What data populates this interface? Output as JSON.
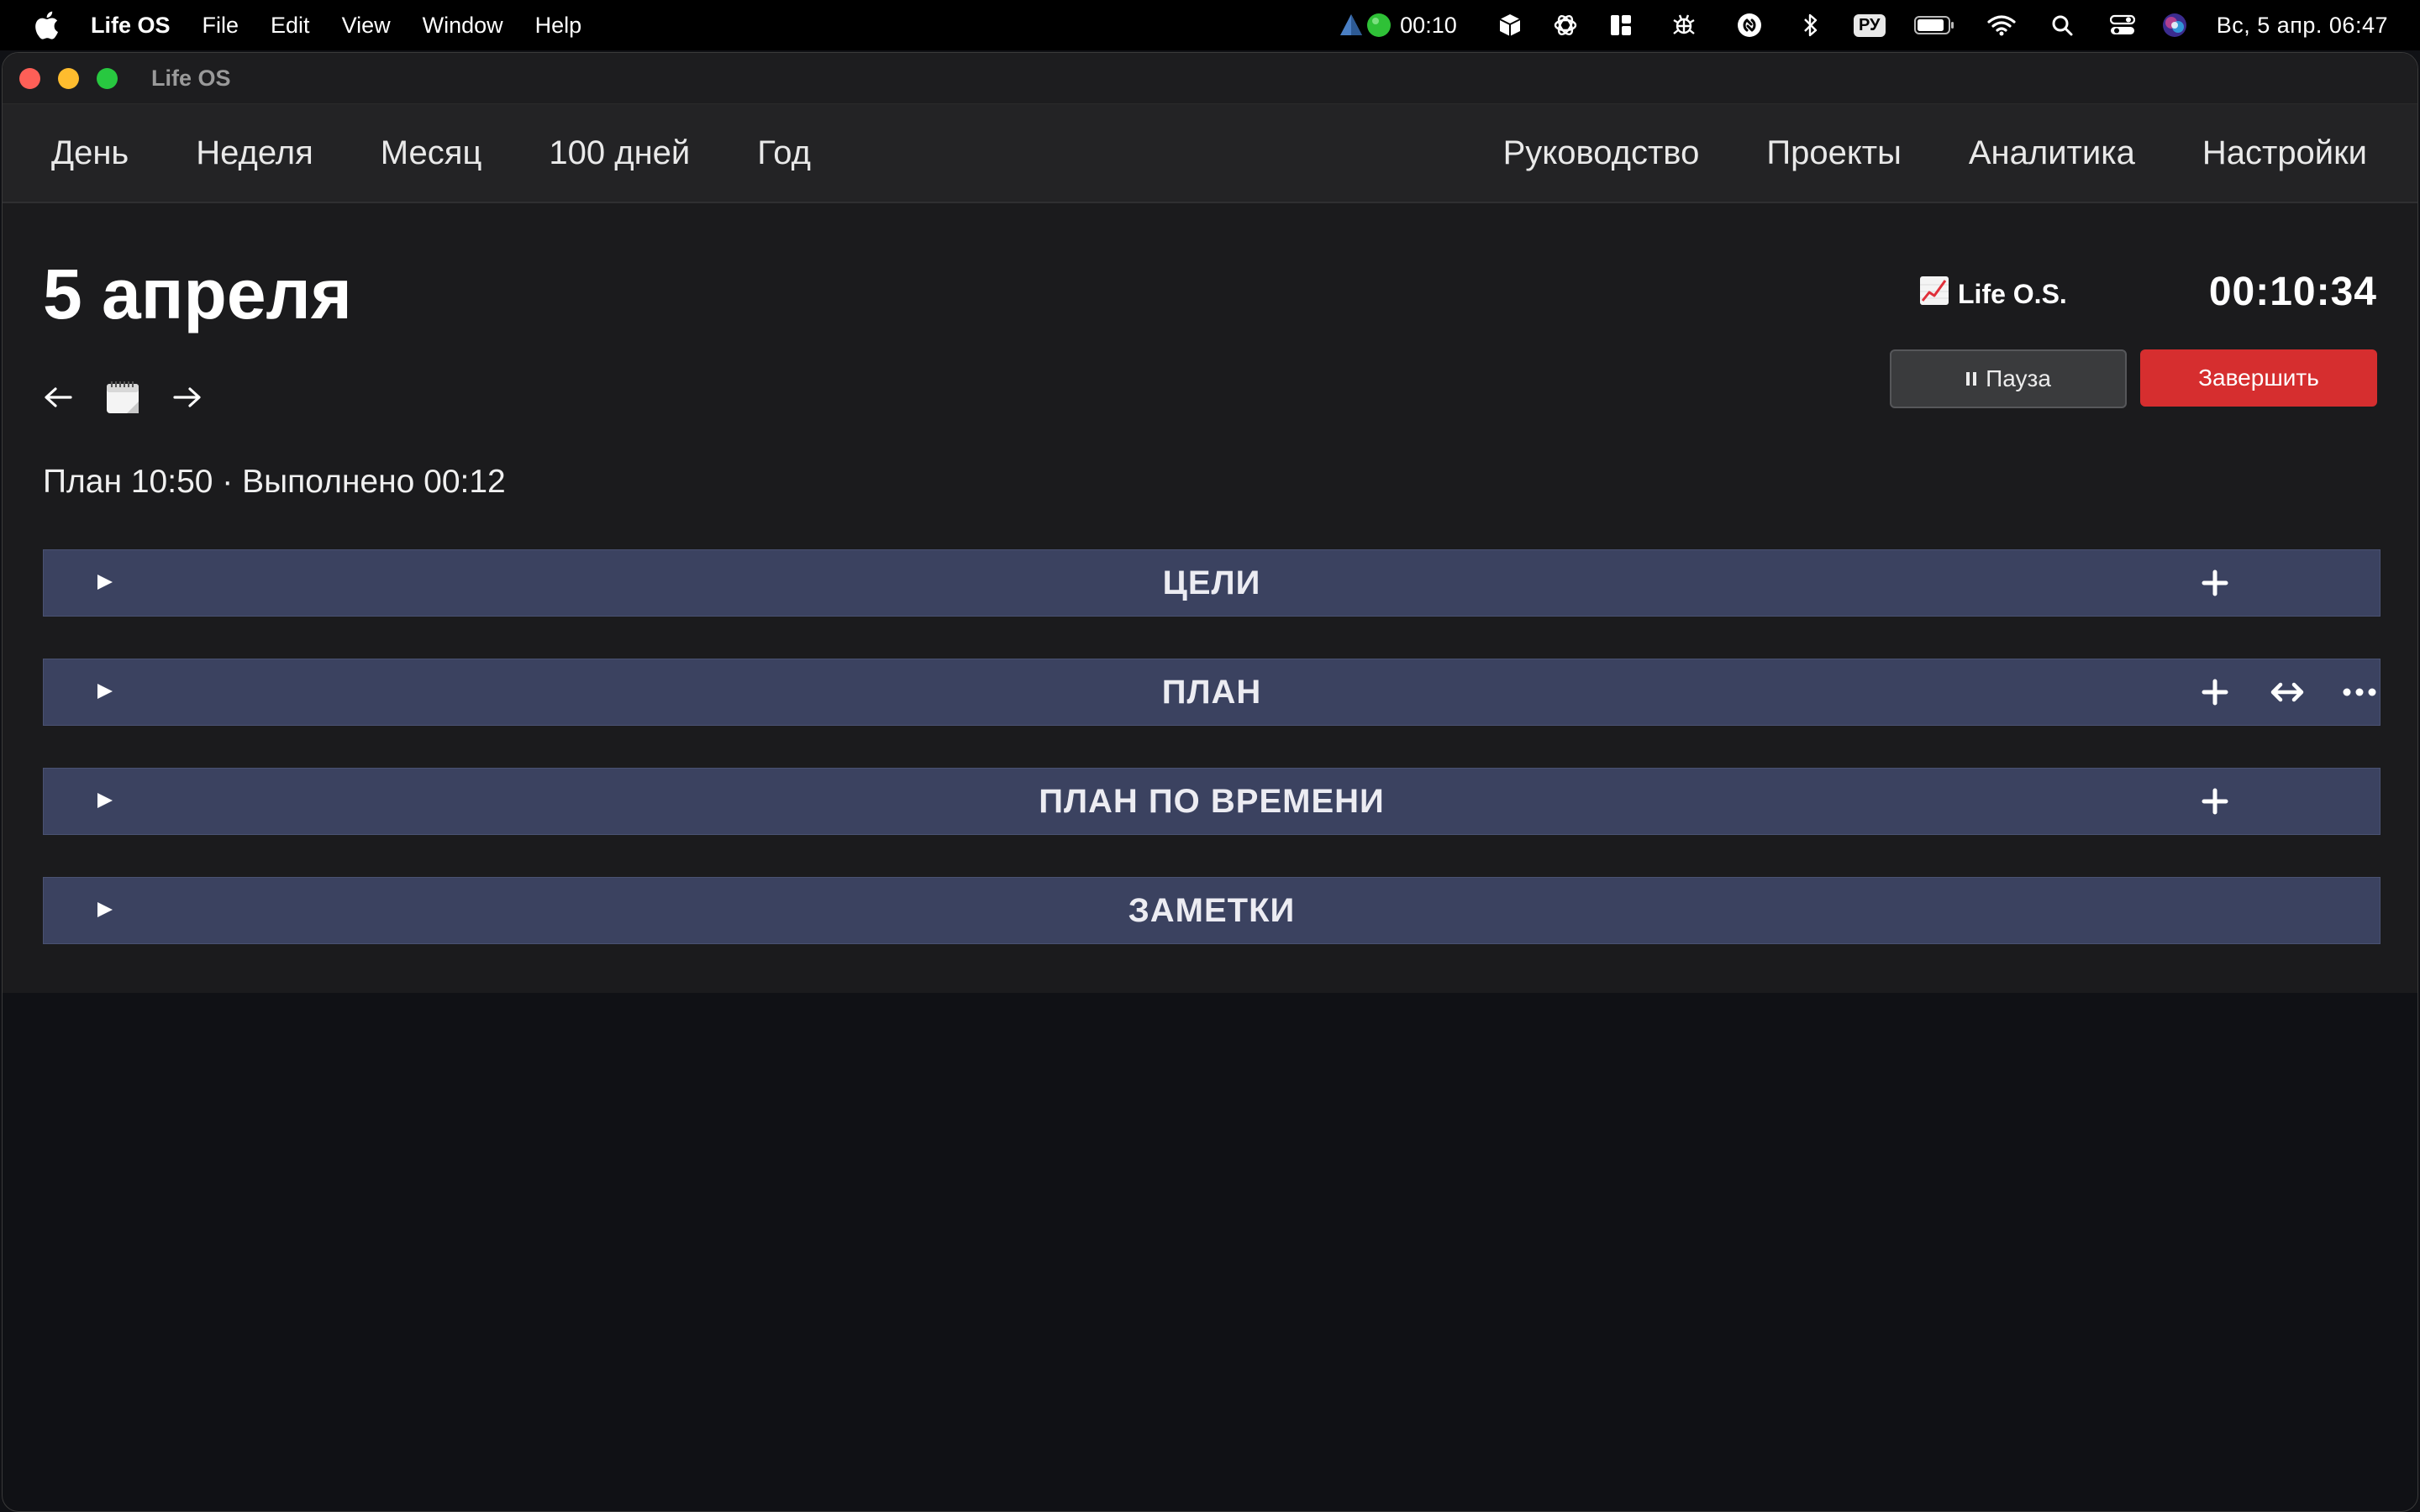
{
  "menubar": {
    "app_name": "Life OS",
    "items": [
      "File",
      "Edit",
      "View",
      "Window",
      "Help"
    ],
    "timer": "00:10",
    "keyboard_layout": "РУ",
    "datetime": "Вс, 5 апр.  06:47"
  },
  "window": {
    "title": "Life OS"
  },
  "nav": {
    "left": [
      "День",
      "Неделя",
      "Месяц",
      "100 дней",
      "Год"
    ],
    "right": [
      "Руководство",
      "Проекты",
      "Аналитика",
      "Настройки"
    ]
  },
  "day": {
    "title": "5 апреля",
    "summary": "План 10:50 · Выполнено 00:12"
  },
  "tracker": {
    "brand": "Life O.S.",
    "timer": "00:10:34",
    "pause_label": "Пауза",
    "finish_label": "Завершить"
  },
  "sections": [
    {
      "title": "ЦЕЛИ"
    },
    {
      "title": "ПЛАН"
    },
    {
      "title": "ПЛАН ПО ВРЕМЕНИ"
    },
    {
      "title": "ЗАМЕТКИ"
    }
  ],
  "colors": {
    "section_bg": "#3b4260",
    "finish_button": "#d62e2f",
    "background": "#101115"
  }
}
